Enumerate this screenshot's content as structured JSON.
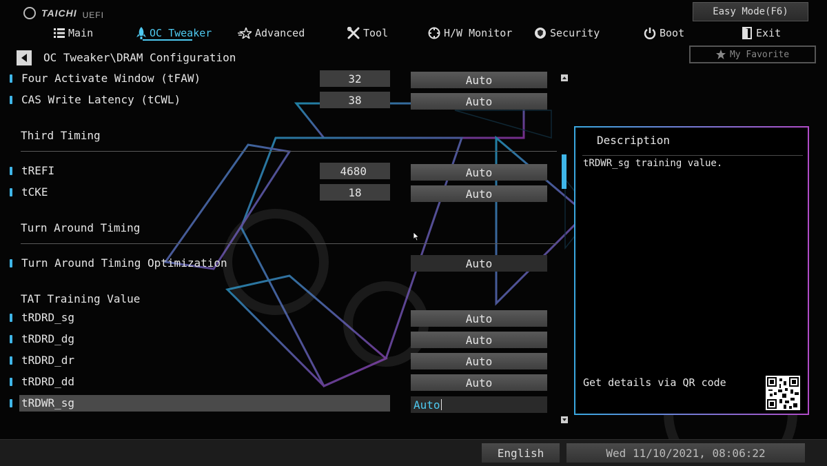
{
  "brand": {
    "logo_text": "TAICHI",
    "logo_sub": "UEFI"
  },
  "easy_mode_label": "Easy Mode(F6)",
  "nav": [
    {
      "label": "Main",
      "icon": "grid-list-icon",
      "active": false
    },
    {
      "label": "OC Tweaker",
      "icon": "rocket-icon",
      "active": true
    },
    {
      "label": "Advanced",
      "icon": "star-icon",
      "active": false
    },
    {
      "label": "Tool",
      "icon": "wrench-icon",
      "active": false
    },
    {
      "label": "H/W Monitor",
      "icon": "monitor-gauge-icon",
      "active": false
    },
    {
      "label": "Security",
      "icon": "shield-badge-icon",
      "active": false
    },
    {
      "label": "Boot",
      "icon": "power-icon",
      "active": false
    },
    {
      "label": "Exit",
      "icon": "exit-door-icon",
      "active": false
    }
  ],
  "favorite_label": "My Favorite",
  "breadcrumb": "OC Tweaker\\DRAM Configuration",
  "settings": [
    {
      "label": "Four Activate Window (tFAW)",
      "current": "32",
      "value": "Auto"
    },
    {
      "label": "CAS Write Latency (tCWL)",
      "current": "38",
      "value": "Auto"
    }
  ],
  "sections": {
    "third_timing": "Third Timing",
    "turn_around": "Turn Around Timing",
    "tat_training": "TAT Training Value"
  },
  "third_timing_rows": [
    {
      "label": "tREFI",
      "current": "4680",
      "value": "Auto"
    },
    {
      "label": "tCKE",
      "current": "18",
      "value": "Auto"
    }
  ],
  "turn_around_rows": [
    {
      "label": "Turn Around Timing Optimization",
      "value": "Auto"
    }
  ],
  "tat_rows": [
    {
      "label": "tRDRD_sg",
      "value": "Auto"
    },
    {
      "label": "tRDRD_dg",
      "value": "Auto"
    },
    {
      "label": "tRDRD_dr",
      "value": "Auto"
    },
    {
      "label": "tRDRD_dd",
      "value": "Auto"
    },
    {
      "label": "tRDWR_sg",
      "value": "Auto",
      "selected": true
    }
  ],
  "description": {
    "title": "Description",
    "text": "tRDWR_sg training value.",
    "qr_label": "Get details via QR code"
  },
  "footer": {
    "language": "English",
    "datetime": "Wed 11/10/2021, 08:06:22"
  },
  "colors": {
    "accent": "#4ec9f0",
    "bullet": "#3fb6e8",
    "panel_border_start": "#3aa8e0",
    "panel_border_end": "#b04cc8"
  }
}
